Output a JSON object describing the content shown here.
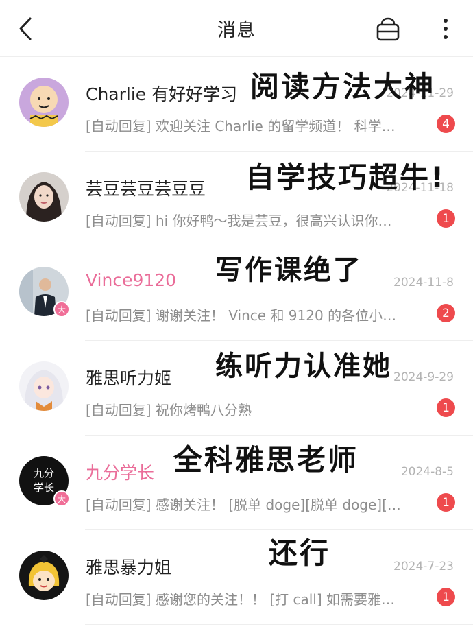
{
  "header": {
    "title": "消息"
  },
  "conversations": [
    {
      "name": "Charlie 有好好学习",
      "date": "2024-11-29",
      "preview": "[自动回复] 欢迎关注 Charlie 的留学频道！ 科学…",
      "unread": "4",
      "note": "阅读方法大神",
      "verified": false,
      "pink": false
    },
    {
      "name": "芸豆芸豆芸豆豆",
      "date": "2024-11-18",
      "preview": "[自动回复] hi 你好鸭～我是芸豆，很高兴认识你…",
      "unread": "1",
      "note": "自学技巧超牛!",
      "verified": false,
      "pink": false
    },
    {
      "name": "Vince9120",
      "date": "2024-11-8",
      "preview": "[自动回复] 谢谢关注！ Vince 和 9120 的各位小…",
      "unread": "2",
      "note": "写作课绝了",
      "verified": true,
      "pink": true,
      "verified_label": "大"
    },
    {
      "name": "雅思听力姬",
      "date": "2024-9-29",
      "preview": "[自动回复] 祝你烤鸭八分熟",
      "unread": "1",
      "note": "练听力认准她",
      "verified": false,
      "pink": false
    },
    {
      "name": "九分学长",
      "date": "2024-8-5",
      "preview": "[自动回复] 感谢关注！ [脱单 doge][脱单 doge][…",
      "unread": "1",
      "note": "全科雅思老师",
      "verified": true,
      "pink": true,
      "verified_label": "大",
      "avatar_text": [
        "九分",
        "学长"
      ]
    },
    {
      "name": "雅思暴力姐",
      "date": "2024-7-23",
      "preview": "[自动回复] 感谢您的关注！！ [打 call] 如需要雅…",
      "unread": "1",
      "note": "还行",
      "verified": false,
      "pink": false
    }
  ],
  "colors": {
    "unread_badge": "#ee4a4d",
    "pink_name": "#ea6d99",
    "verified_badge": "#f06e97"
  },
  "icons": [
    "back-arrow-icon",
    "shop-basket-icon",
    "more-vertical-icon"
  ]
}
